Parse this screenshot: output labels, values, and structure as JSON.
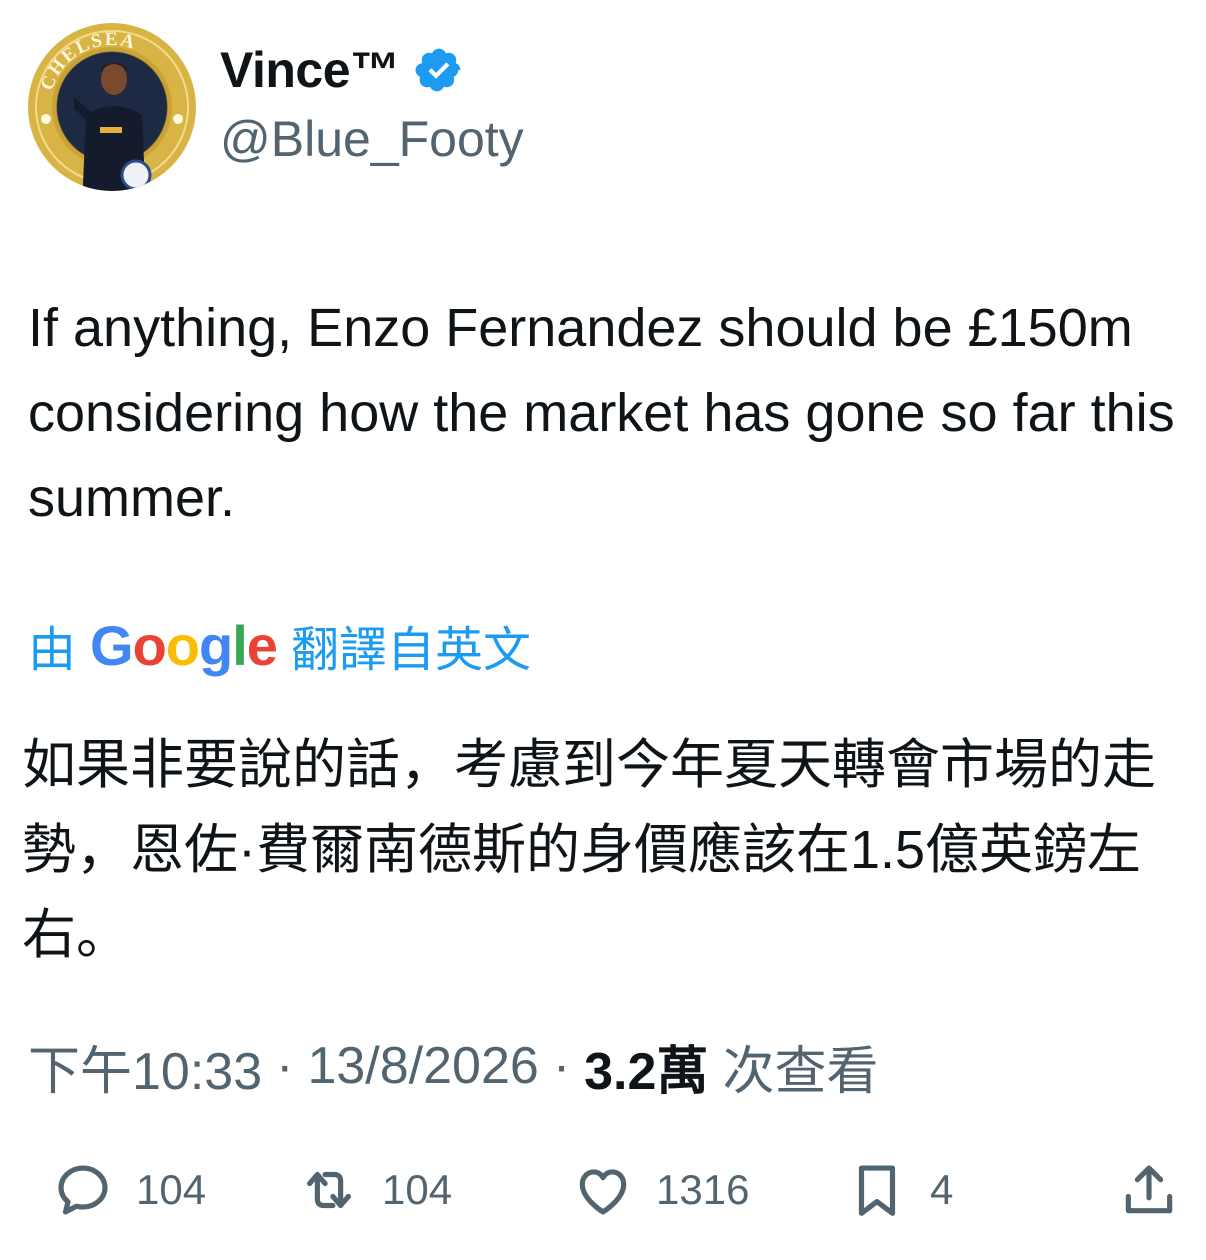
{
  "author": {
    "display_name": "Vince™",
    "handle": "@Blue_Footy",
    "verified": true,
    "avatar_ring_text": "CHELSEA"
  },
  "tweet": {
    "text": "If anything, Enzo Fernandez should be £150m considering how the market has gone so far this summer."
  },
  "translation": {
    "prefix": "由",
    "logo_letters": [
      "G",
      "o",
      "o",
      "g",
      "l",
      "e"
    ],
    "suffix": "翻譯自英文",
    "text": "如果非要說的話，考慮到今年夏天轉會市場的走勢，恩佐·費爾南德斯的身價應該在1.5億英鎊左右。"
  },
  "meta": {
    "time": "下午10:33",
    "separator": "·",
    "date": "13/8/2026",
    "views_count": "3.2萬",
    "views_label": "次查看"
  },
  "actions": {
    "reply_count": "104",
    "retweet_count": "104",
    "like_count": "1316",
    "bookmark_count": "4"
  },
  "colors": {
    "link_blue": "#1d9bf0",
    "secondary_text": "#536471",
    "primary_text": "#0f1419",
    "avatar_gold": "#d8b446",
    "avatar_navy": "#1e2a44"
  }
}
